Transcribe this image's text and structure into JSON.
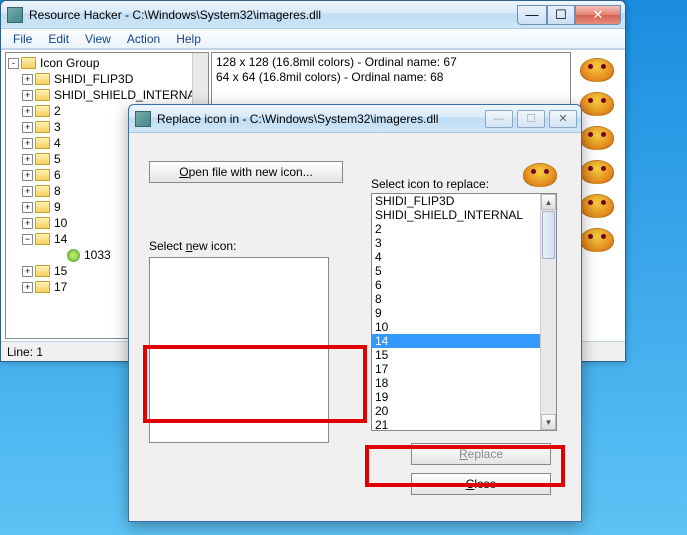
{
  "main": {
    "title": "Resource Hacker  -  C:\\Windows\\System32\\imageres.dll",
    "menu": [
      "File",
      "Edit",
      "View",
      "Action",
      "Help"
    ],
    "status": "Line: 1",
    "content_lines": [
      "128 x 128 (16.8mil colors) - Ordinal name: 67",
      "64 x 64 (16.8mil colors) - Ordinal name: 68"
    ]
  },
  "tree": {
    "root": "Icon Group",
    "items": [
      {
        "label": "SHIDI_FLIP3D",
        "exp": "+"
      },
      {
        "label": "SHIDI_SHIELD_INTERNAL",
        "exp": "+"
      },
      {
        "label": "2",
        "exp": "+"
      },
      {
        "label": "3",
        "exp": "+"
      },
      {
        "label": "4",
        "exp": "+"
      },
      {
        "label": "5",
        "exp": "+"
      },
      {
        "label": "6",
        "exp": "+"
      },
      {
        "label": "8",
        "exp": "+"
      },
      {
        "label": "9",
        "exp": "+"
      },
      {
        "label": "10",
        "exp": "+"
      },
      {
        "label": "14",
        "exp": "−",
        "open": true,
        "children": [
          {
            "label": "1033"
          }
        ]
      },
      {
        "label": "15",
        "exp": "+"
      },
      {
        "label": "17",
        "exp": "+"
      }
    ]
  },
  "dialog": {
    "title": "Replace icon in - C:\\Windows\\System32\\imageres.dll",
    "open_button": "Open file with new icon...",
    "select_new_label": "Select new icon:",
    "select_replace_label": "Select icon to replace:",
    "list": [
      "SHIDI_FLIP3D",
      "SHIDI_SHIELD_INTERNAL",
      "2",
      "3",
      "4",
      "5",
      "6",
      "8",
      "9",
      "10",
      "14",
      "15",
      "17",
      "18",
      "19",
      "20",
      "21"
    ],
    "selected": "14",
    "replace_button": "Replace",
    "close_button": "Close"
  }
}
